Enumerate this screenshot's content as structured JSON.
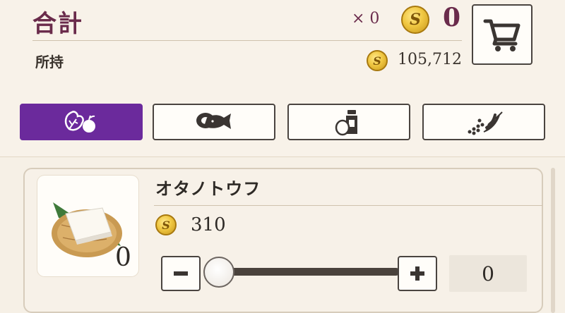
{
  "header": {
    "total_label": "合計",
    "multiplier": "× 0",
    "total_cost": "0",
    "owned_label": "所持",
    "owned_amount": "105,712"
  },
  "cart": {
    "icon": "cart-icon"
  },
  "tabs": [
    {
      "icon": "vegetable-fruit-icon",
      "active": true
    },
    {
      "icon": "meat-fish-icon",
      "active": false
    },
    {
      "icon": "egg-jar-icon",
      "active": false
    },
    {
      "icon": "spice-pepper-icon",
      "active": false
    }
  ],
  "item": {
    "name": "オタノトウフ",
    "price": "310",
    "owned_count": "0",
    "quantity": "0",
    "slider_fraction": 0
  },
  "colors": {
    "accent": "#6b2a9c",
    "title": "#6a2b4b",
    "coin": "#f0c742"
  }
}
